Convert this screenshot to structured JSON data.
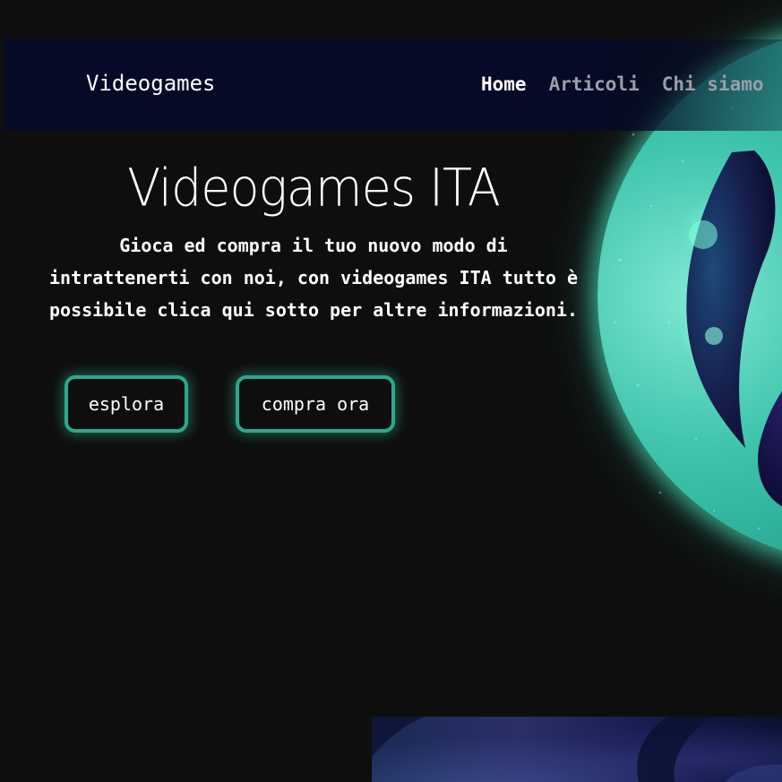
{
  "navbar": {
    "brand": "Videogames",
    "links": [
      {
        "label": "Home",
        "active": true
      },
      {
        "label": "Articoli",
        "active": false
      },
      {
        "label": "Chi siamo",
        "active": false
      }
    ]
  },
  "hero": {
    "title": "Videogames ITA",
    "description": "Gioca ed compra il tuo nuovo modo di intrattenerti con noi, con videogames ITA tutto è possibile clica qui sotto per altre informazioni.",
    "buttons": {
      "explore": "esplora",
      "buy": "compra ora"
    }
  },
  "colors": {
    "background": "#0e0e0e",
    "navbar": "#050a26",
    "accent": "#2aa98c",
    "text": "#ffffff",
    "nav_inactive": "#9a9ea8"
  },
  "images": {
    "hero_art": "game-logo-orb",
    "bottom_art": "abstract-blue-banner"
  }
}
